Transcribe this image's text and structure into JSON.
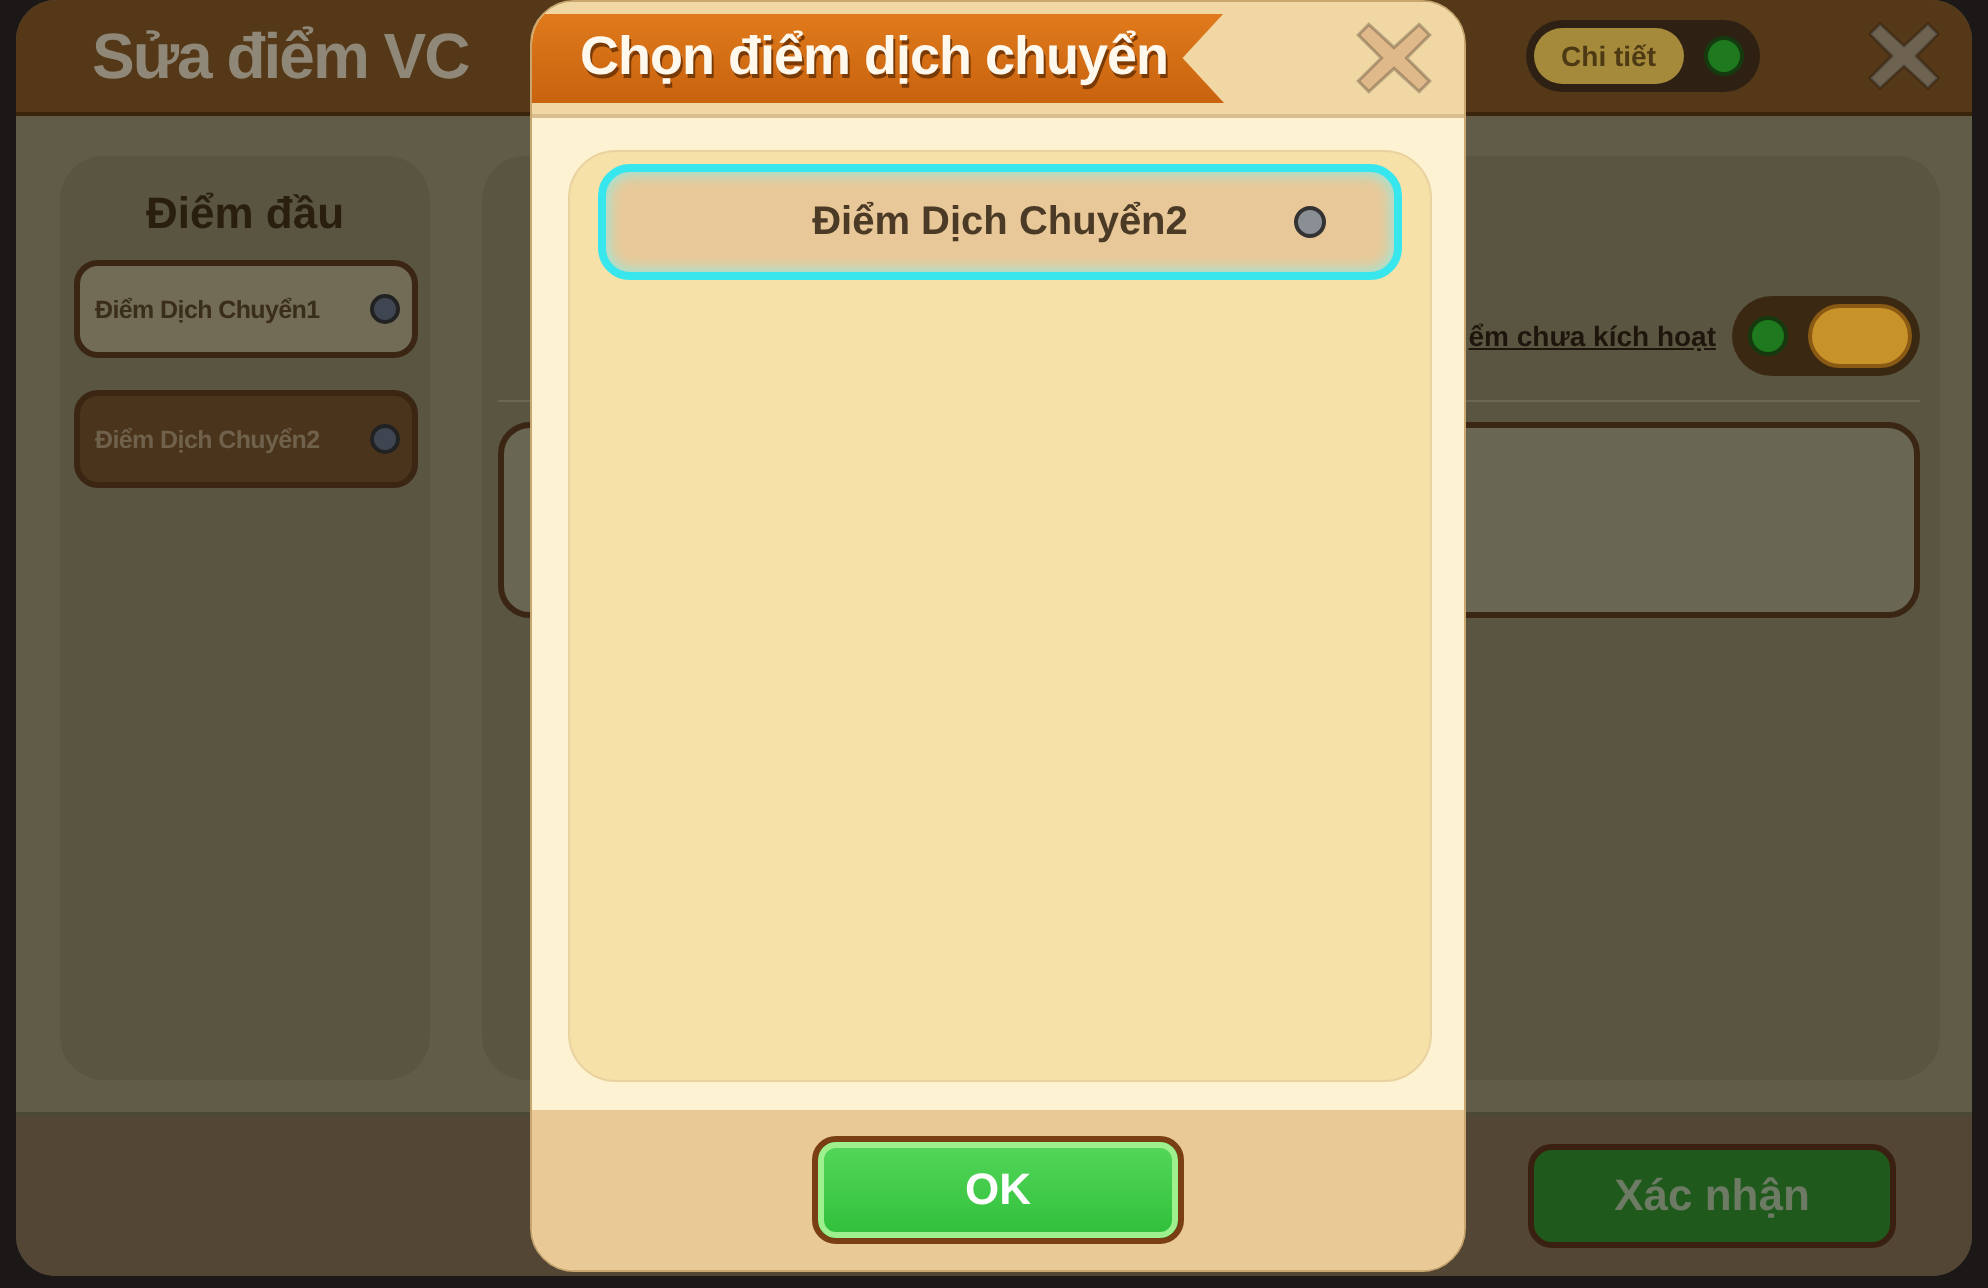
{
  "background_dialog": {
    "title": "Sửa điểm VC",
    "detail_toggle": {
      "label": "Chi tiết",
      "lit": true
    },
    "start_point": {
      "heading": "Điểm đầu",
      "items": [
        {
          "label": "Điểm Dịch Chuyển1",
          "selected": false
        },
        {
          "label": "Điểm Dịch Chuyển2",
          "selected": true
        }
      ]
    },
    "inactive_filter": {
      "label": "ểm chưa kích hoạt",
      "lit": true
    },
    "confirm_button": "Xác nhận"
  },
  "modal": {
    "title": "Chọn điểm dịch chuyển",
    "items": [
      {
        "label": "Điểm Dịch Chuyển2",
        "selected": true
      }
    ],
    "ok_button": "OK"
  }
}
